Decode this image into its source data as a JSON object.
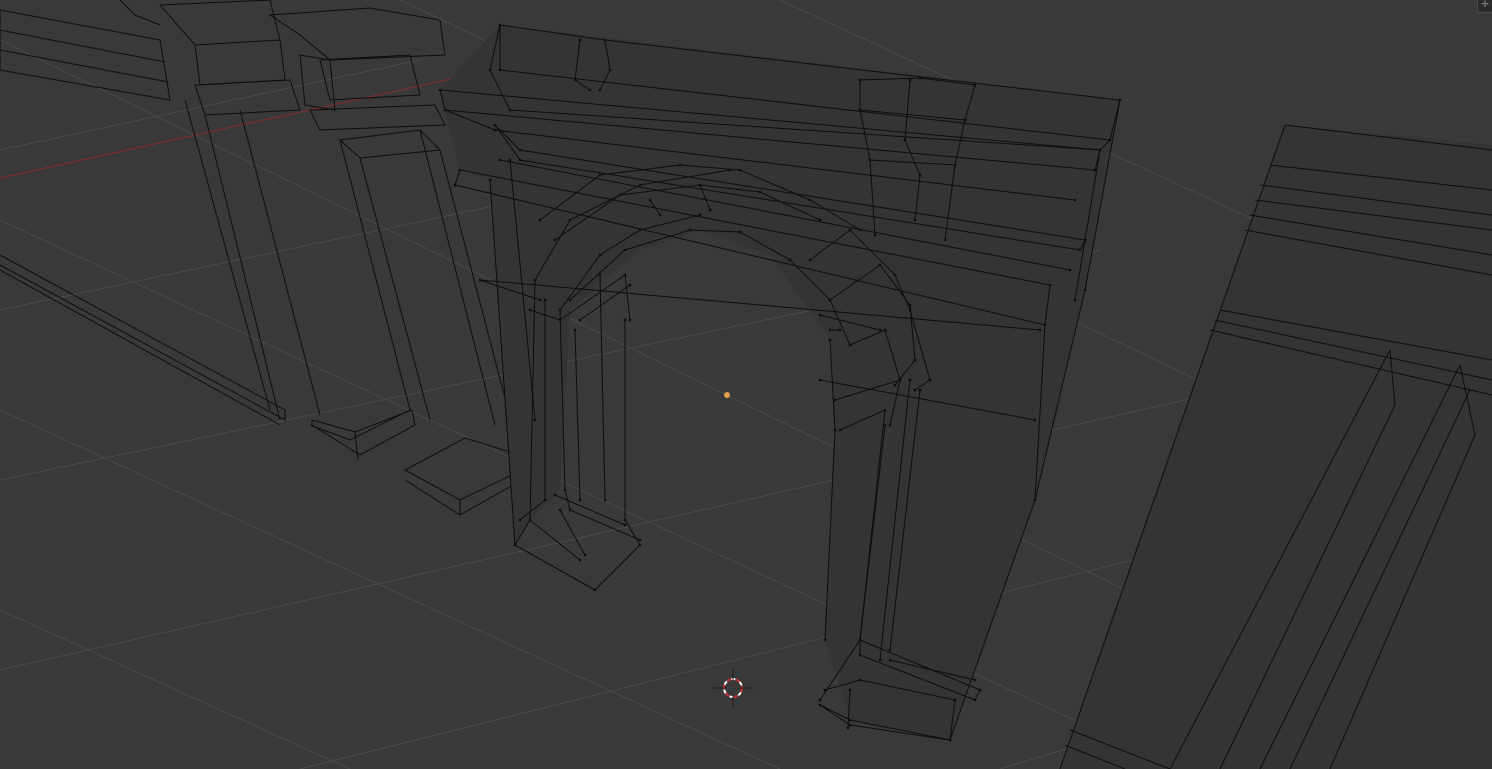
{
  "viewport": {
    "mode": "wireframe-edit",
    "background_color": "#393939",
    "grid_color": "#4a4a4a",
    "x_axis_color": "#7a2f2f",
    "edge_color": "#0d0d0d",
    "origin_color": "#e0a050",
    "cursor_color": "#c83232"
  },
  "icons": {
    "corner": "area-split-icon",
    "cursor": "3d-cursor-icon",
    "origin": "object-origin-icon"
  }
}
